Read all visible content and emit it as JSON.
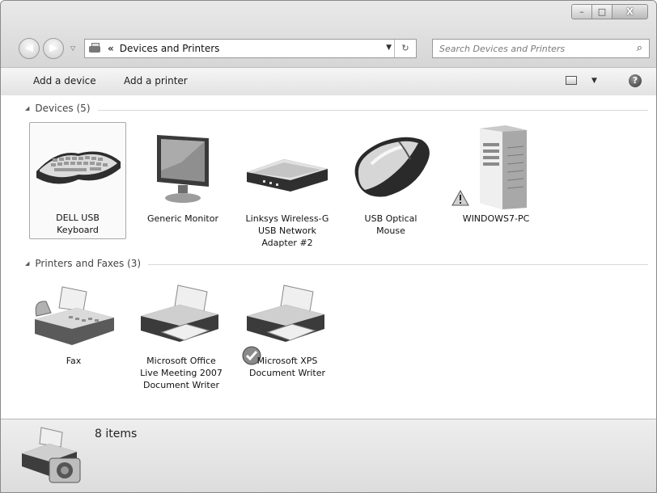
{
  "window": {
    "caption": {
      "minimize": "–",
      "maximize": "□",
      "close": "X"
    }
  },
  "nav": {
    "back_glyph": "◀",
    "forward_glyph": "▶",
    "recent_glyph": "▽"
  },
  "address": {
    "chevron": "«",
    "path": "Devices and Printers",
    "dropdown_glyph": "▼",
    "refresh_glyph": "↻"
  },
  "search": {
    "placeholder": "Search Devices and Printers",
    "icon_glyph": "⌕"
  },
  "toolbar": {
    "add_device": "Add a device",
    "add_printer": "Add a printer",
    "views_drop": "▼",
    "help": "?"
  },
  "groups": {
    "devices": {
      "header": "Devices (5)",
      "items": [
        {
          "label_lines": [
            "DELL USB",
            "Keyboard"
          ],
          "icon": "keyboard-icon",
          "selected": true
        },
        {
          "label_lines": [
            "Generic Monitor"
          ],
          "icon": "monitor-icon"
        },
        {
          "label_lines": [
            "Linksys Wireless-G",
            "USB Network",
            "Adapter #2"
          ],
          "icon": "network-adapter-icon"
        },
        {
          "label_lines": [
            "USB Optical",
            "Mouse"
          ],
          "icon": "mouse-icon"
        },
        {
          "label_lines": [
            "WINDOWS7-PC"
          ],
          "icon": "computer-tower-icon",
          "warning": true
        }
      ]
    },
    "printers": {
      "header": "Printers and Faxes (3)",
      "items": [
        {
          "label_lines": [
            "Fax"
          ],
          "icon": "fax-icon"
        },
        {
          "label_lines": [
            "Microsoft Office",
            "Live Meeting 2007",
            "Document Writer"
          ],
          "icon": "printer-icon"
        },
        {
          "label_lines": [
            "Microsoft XPS",
            "Document Writer"
          ],
          "icon": "printer-icon",
          "default": true
        }
      ]
    }
  },
  "status": {
    "count": "8 items",
    "icon": "printer-camera-icon"
  }
}
